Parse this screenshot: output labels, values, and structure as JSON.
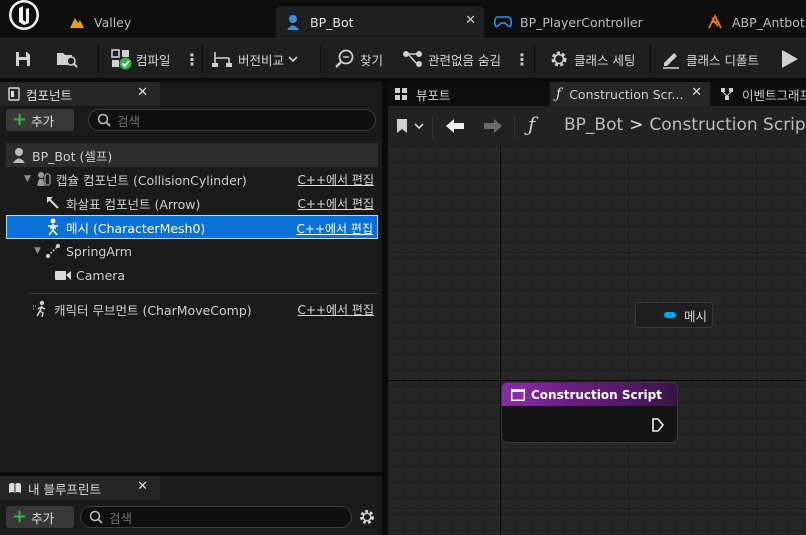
{
  "tabs": [
    {
      "label": "Valley",
      "icon": "level-icon"
    },
    {
      "label": "BP_Bot",
      "icon": "pawn-icon",
      "active": true
    },
    {
      "label": "BP_PlayerController",
      "icon": "gamepad-icon"
    },
    {
      "label": "ABP_Antbot",
      "icon": "anim-blueprint-icon"
    }
  ],
  "toolbar": {
    "compile": "컴파일",
    "diff": "버전비교",
    "find": "찾기",
    "hide_unrelated": "관련없음 숨김",
    "class_settings": "클래스 세팅",
    "class_defaults": "클래스 디폴트"
  },
  "components": {
    "title": "컴포넌트",
    "add": "추가",
    "search_placeholder": "검색",
    "tree": [
      {
        "label": "BP_Bot (셀프)",
        "depth": 0,
        "icon": "self-icon"
      },
      {
        "label": "캡슐 컴포넌트 (CollisionCylinder)",
        "depth": 1,
        "icon": "capsule-icon",
        "cpp": "C++에서 편집"
      },
      {
        "label": "화살표 컴포넌트 (Arrow)",
        "depth": 2,
        "icon": "arrow-icon",
        "cpp": "C++에서 편집"
      },
      {
        "label": "메시 (CharacterMesh0)",
        "depth": 2,
        "icon": "skeletal-mesh-icon",
        "cpp": "C++에서 편집",
        "selected": true
      },
      {
        "label": "SpringArm",
        "depth": 2,
        "icon": "spring-arm-icon"
      },
      {
        "label": "Camera",
        "depth": 3,
        "icon": "camera-icon"
      },
      {
        "label": "캐릭터 무브먼트 (CharMoveComp)",
        "depth": 1,
        "icon": "movement-icon",
        "cpp": "C++에서 편집"
      }
    ]
  },
  "myblueprint": {
    "title": "내 블루프린트",
    "add": "추가",
    "search_placeholder": "검색"
  },
  "right_tabs": [
    {
      "label": "뷰포트",
      "icon": "viewport-icon"
    },
    {
      "label": "Construction Scr...",
      "icon": "function-icon",
      "active": true
    },
    {
      "label": "이벤트그래프",
      "icon": "event-graph-icon"
    }
  ],
  "breadcrumb": {
    "root": "BP_Bot",
    "separator": ">",
    "current": "Construction Script"
  },
  "graph": {
    "var_node": "메시",
    "entry_node": "Construction Script",
    "colors": {
      "entry_header": "#8a2da8",
      "object_pin": "#00a8f0",
      "selection": "#0870d8",
      "accent_green": "#36b34a"
    }
  }
}
